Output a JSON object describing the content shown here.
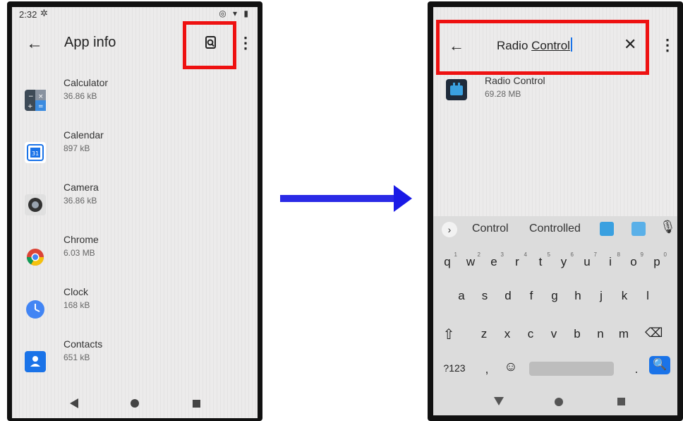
{
  "left_screen": {
    "status_time": "2:32",
    "title": "App info",
    "apps": [
      {
        "name": "Calculator",
        "size": "36.86 kB",
        "icon": "calculator-icon",
        "color": "#4a5a6a"
      },
      {
        "name": "Calendar",
        "size": "897 kB",
        "icon": "calendar-icon",
        "color": "#1a73e8"
      },
      {
        "name": "Camera",
        "size": "36.86 kB",
        "icon": "camera-icon",
        "color": "#3a3a3a"
      },
      {
        "name": "Chrome",
        "size": "6.03 MB",
        "icon": "chrome-icon",
        "color": "#db4437"
      },
      {
        "name": "Clock",
        "size": "168 kB",
        "icon": "clock-icon",
        "color": "#4285f4"
      },
      {
        "name": "Contacts",
        "size": "651 kB",
        "icon": "contacts-icon",
        "color": "#1a73e8"
      }
    ]
  },
  "right_screen": {
    "search_query_1": "Radio ",
    "search_query_2": "Control",
    "result": {
      "name": "Radio Control",
      "size": "69.28 MB",
      "icon": "radio-control-icon"
    },
    "suggestions": [
      "Control",
      "Controlled"
    ],
    "keyboard_rows": [
      [
        "q",
        "w",
        "e",
        "r",
        "t",
        "y",
        "u",
        "i",
        "o",
        "p"
      ],
      [
        "a",
        "s",
        "d",
        "f",
        "g",
        "h",
        "j",
        "k",
        "l"
      ],
      [
        "z",
        "x",
        "c",
        "v",
        "b",
        "n",
        "m"
      ]
    ],
    "key_numbers": [
      "1",
      "2",
      "3",
      "4",
      "5",
      "6",
      "7",
      "8",
      "9",
      "0"
    ],
    "symbols_key": "?123",
    "comma_key": ",",
    "period_key": "."
  },
  "colors": {
    "highlight": "#ee1111",
    "arrow": "#2a2ae6",
    "accent": "#1a73e8"
  }
}
